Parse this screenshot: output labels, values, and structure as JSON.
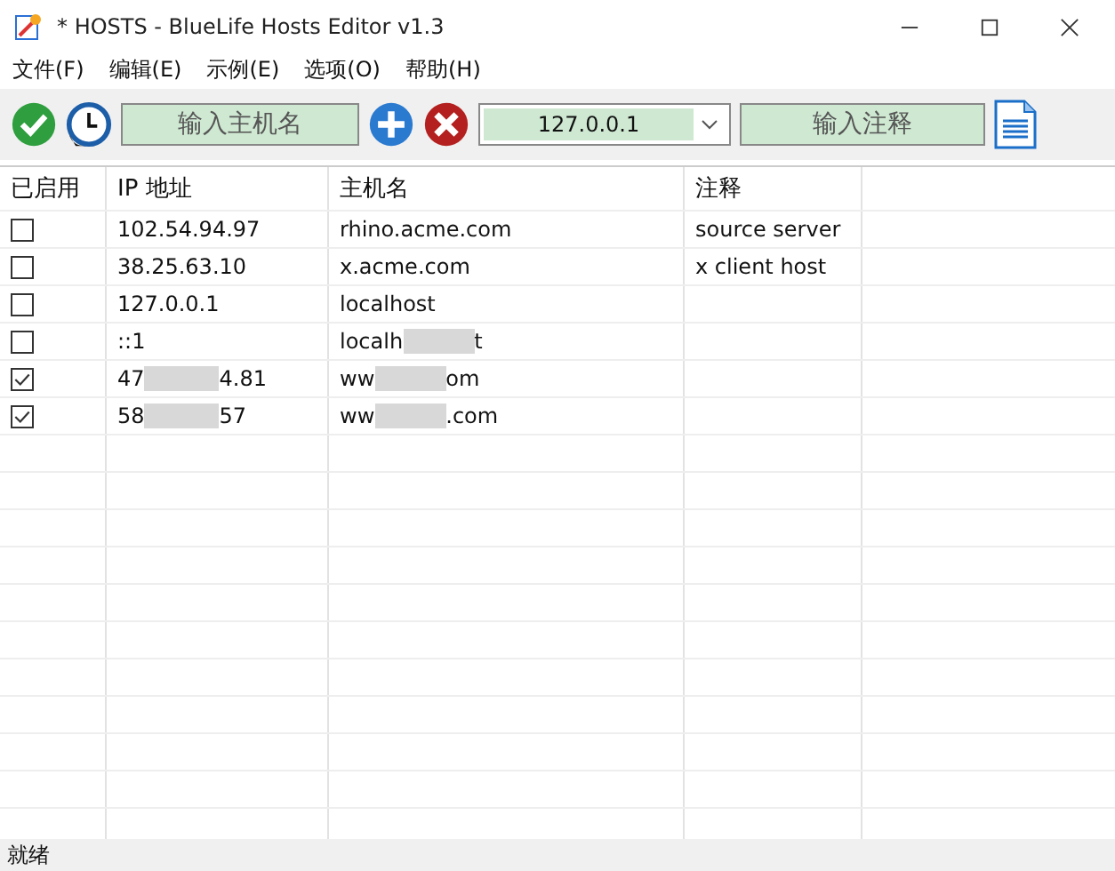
{
  "window": {
    "title": "* HOSTS - BlueLife Hosts Editor v1.3"
  },
  "menu": [
    "文件(F)",
    "编辑(E)",
    "示例(E)",
    "选项(O)",
    "帮助(H)"
  ],
  "toolbar": {
    "hostname_placeholder": "输入主机名",
    "ip_value": "127.0.0.1",
    "comment_placeholder": "输入注释"
  },
  "table": {
    "columns": [
      "已启用",
      "IP 地址",
      "主机名",
      "注释"
    ],
    "rows": [
      {
        "enabled": false,
        "ip": [
          "102.54.94.97"
        ],
        "host": [
          "rhino.acme.com"
        ],
        "comment": "source server"
      },
      {
        "enabled": false,
        "ip": [
          "38.25.63.10"
        ],
        "host": [
          "x.acme.com"
        ],
        "comment": "x client host"
      },
      {
        "enabled": false,
        "ip": [
          "127.0.0.1"
        ],
        "host": [
          "localhost"
        ]
      },
      {
        "enabled": false,
        "ip": [
          "::1"
        ],
        "host": [
          "localh",
          "t"
        ]
      },
      {
        "enabled": true,
        "ip": [
          "47",
          "4.81"
        ],
        "host": [
          "ww",
          "om"
        ]
      },
      {
        "enabled": true,
        "ip": [
          "58",
          "57"
        ],
        "host": [
          "ww",
          ".com"
        ]
      }
    ]
  },
  "status_bar": "就绪"
}
